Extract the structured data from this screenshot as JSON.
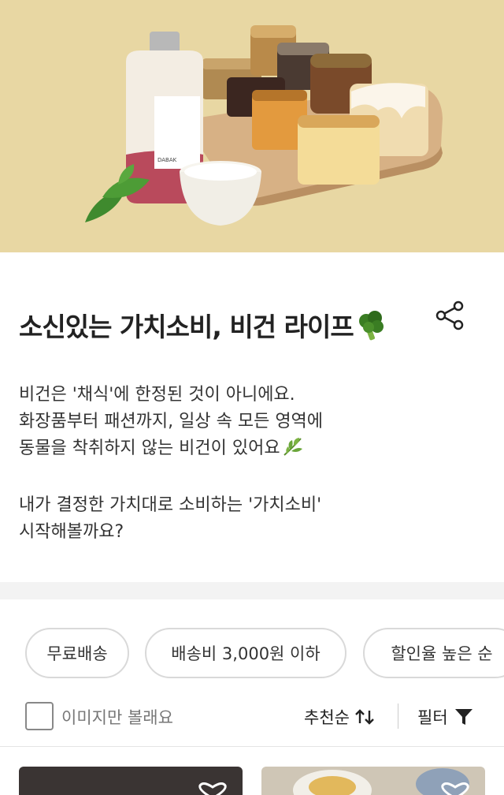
{
  "hero": {
    "bottle_label": "DABAK",
    "colors": {
      "background": "#e8d7a3",
      "board": "#d8b58a",
      "bottle": "#f2ece2",
      "berry": "#b94a5c"
    }
  },
  "header": {
    "title": "소신있는 가치소비, 비건 라이프",
    "title_emoji": "broccoli-icon",
    "share_icon": "share-icon"
  },
  "description": {
    "lines": [
      "비건은 '채식'에 한정된 것이 아니에요.",
      "화장품부터 패션까지, 일상 속 모든 영역에",
      "동물을 착취하지 않는 비건이 있어요"
    ],
    "lines2": [
      "내가 결정한 가치대로 소비하는 '가치소비'",
      "시작해볼까요?"
    ],
    "leaf_icon": "herb-icon"
  },
  "filters": {
    "chips": [
      "무료배송",
      "배송비 3,000원 이하",
      "할인율 높은 순"
    ]
  },
  "toolbar": {
    "image_only_label": "이미지만 볼래요",
    "image_only_checked": false,
    "sort_label": "추천순",
    "filter_label": "필터"
  },
  "colors": {
    "chip_border": "#d9d9d9",
    "text_primary": "#222222",
    "text_secondary": "#777777"
  }
}
